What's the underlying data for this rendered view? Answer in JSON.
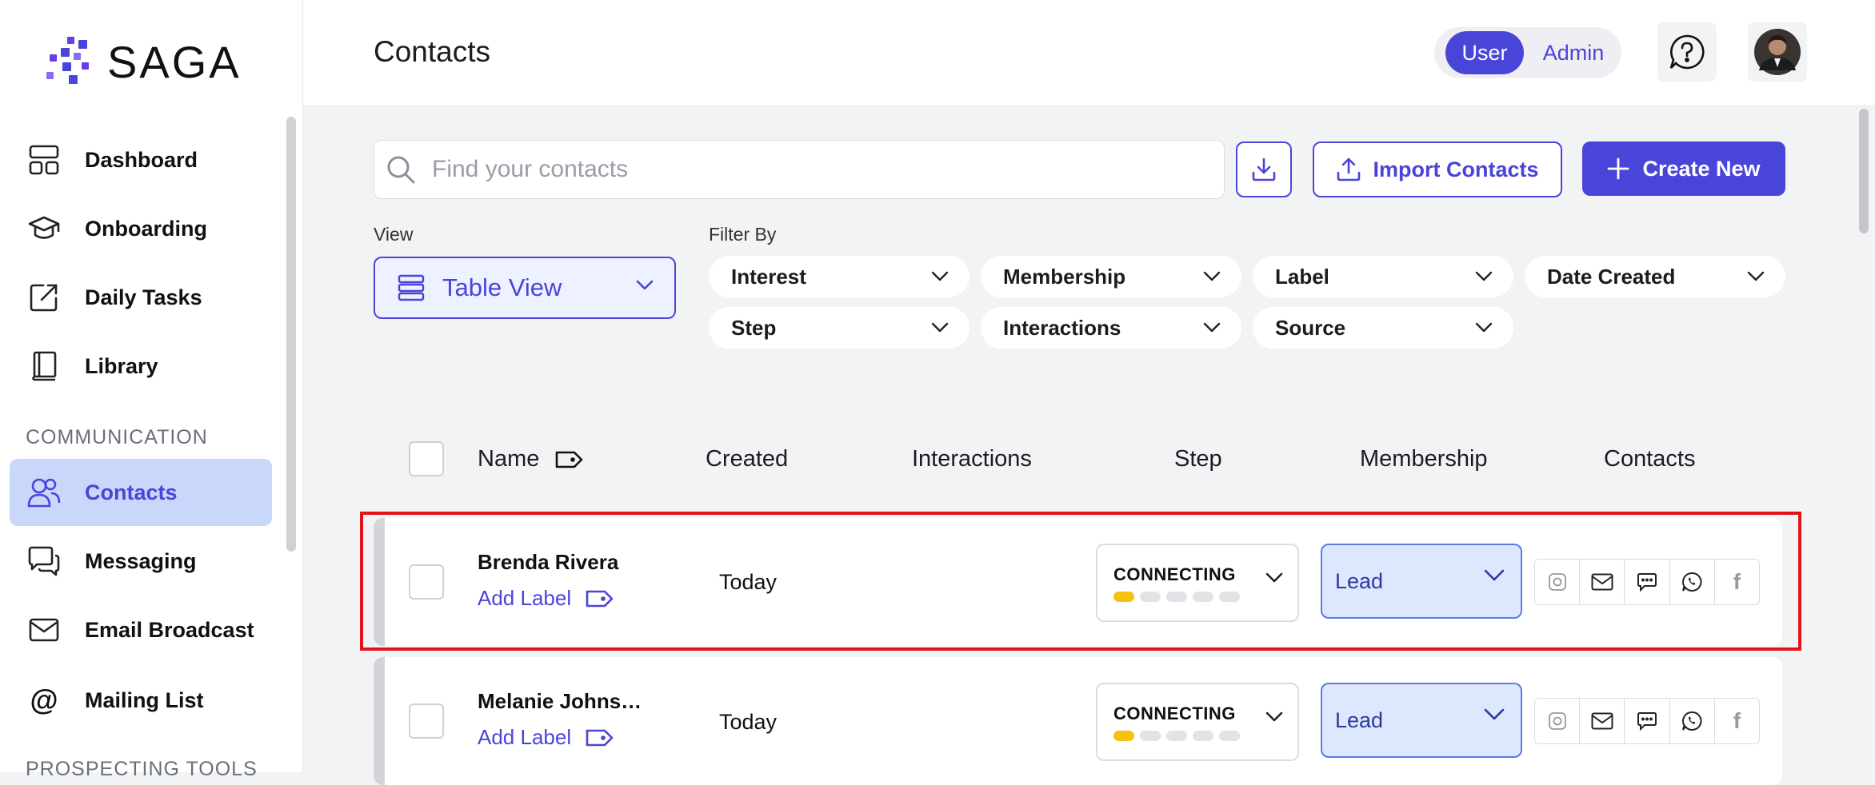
{
  "app": {
    "name": "SAGA"
  },
  "sidebar": {
    "items": [
      {
        "label": "Dashboard",
        "icon": "dashboard-icon"
      },
      {
        "label": "Onboarding",
        "icon": "graduation-cap-icon"
      },
      {
        "label": "Daily Tasks",
        "icon": "edit-square-icon"
      },
      {
        "label": "Library",
        "icon": "book-icon"
      }
    ],
    "section_communication": "COMMUNICATION",
    "comm_items": [
      {
        "label": "Contacts",
        "icon": "users-icon",
        "active": true
      },
      {
        "label": "Messaging",
        "icon": "chat-bubbles-icon"
      },
      {
        "label": "Email Broadcast",
        "icon": "envelope-icon"
      },
      {
        "label": "Mailing List",
        "icon": "at-sign-icon"
      }
    ],
    "section_prospecting": "PROSPECTING TOOLS"
  },
  "header": {
    "title": "Contacts",
    "role_user": "User",
    "role_admin": "Admin"
  },
  "toolbar": {
    "search_placeholder": "Find your contacts",
    "import_label": "Import Contacts",
    "create_label": "Create New"
  },
  "view": {
    "label": "View",
    "selected": "Table View"
  },
  "filters": {
    "label": "Filter By",
    "items": [
      "Interest",
      "Membership",
      "Label",
      "Date Created",
      "Step",
      "Interactions",
      "Source"
    ]
  },
  "table": {
    "columns": [
      "Name",
      "Created",
      "Interactions",
      "Step",
      "Membership",
      "Contacts"
    ],
    "rows": [
      {
        "name": "Brenda Rivera",
        "add_label": "Add Label",
        "created": "Today",
        "step": "CONNECTING",
        "step_progress": 1,
        "step_total": 5,
        "membership": "Lead"
      },
      {
        "name": "Melanie Johns…",
        "add_label": "Add Label",
        "created": "Today",
        "step": "CONNECTING",
        "step_progress": 1,
        "step_total": 5,
        "membership": "Lead"
      }
    ]
  },
  "colors": {
    "accent": "#4a45d9",
    "active_bg": "#c9d7fb",
    "step_on": "#f4c20d",
    "highlight": "#e3131b"
  }
}
